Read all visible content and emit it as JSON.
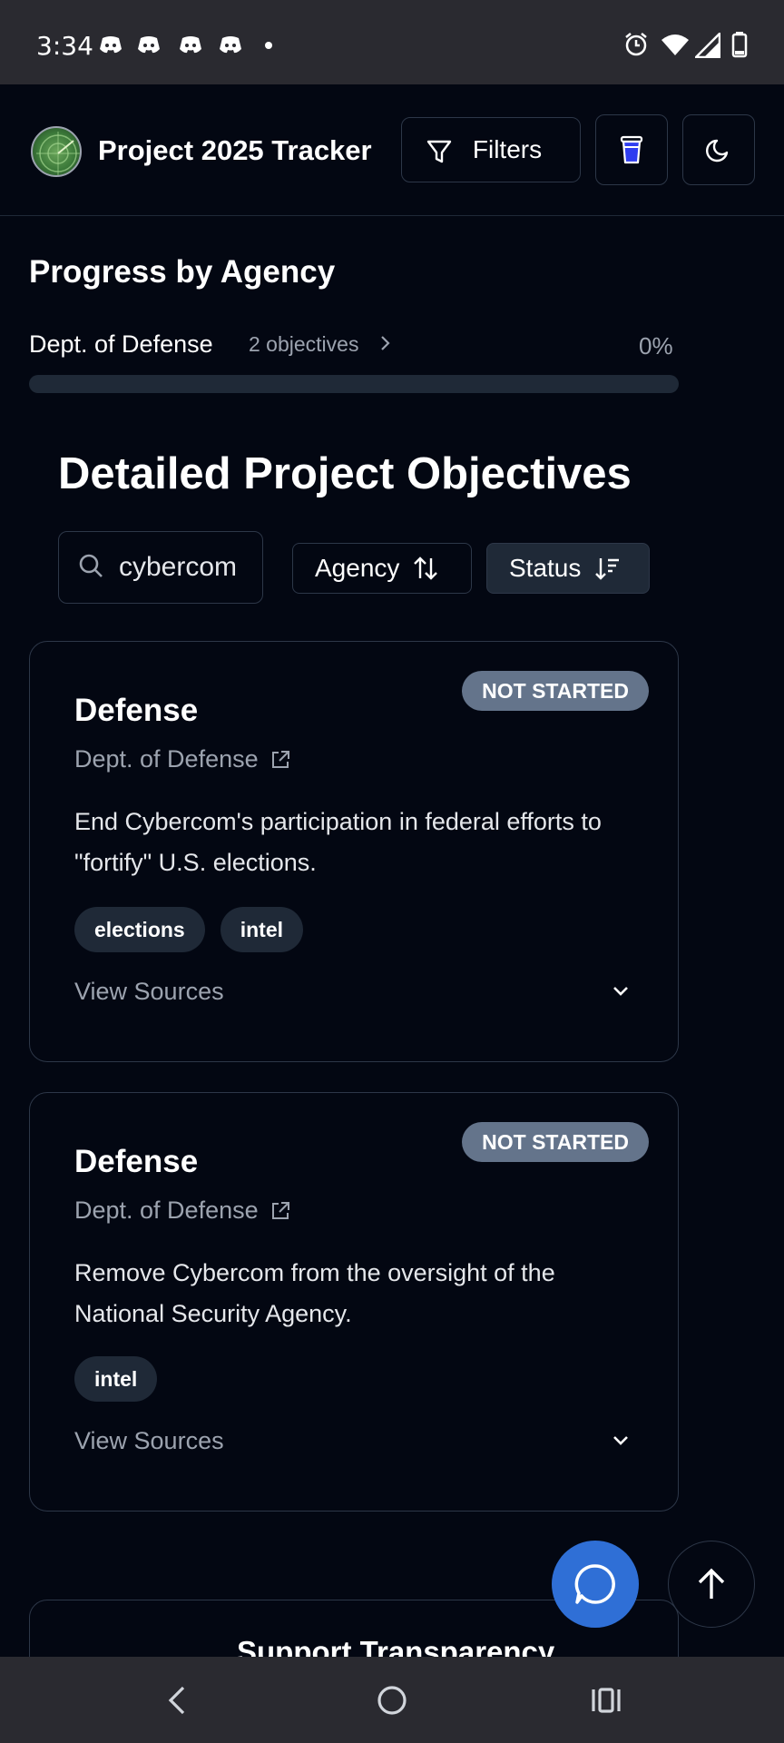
{
  "status_bar": {
    "time": "3:34",
    "notification_icons": [
      "discord-icon",
      "discord-icon",
      "discord-icon",
      "discord-icon"
    ],
    "right_icons": [
      "alarm-icon",
      "wifi-icon",
      "signal-icon",
      "battery-icon"
    ]
  },
  "header": {
    "app_title": "Project 2025 Tracker",
    "filters_label": "Filters",
    "icons": {
      "filter": "filter-icon",
      "cup": "coffee-cup-icon",
      "theme": "moon-icon"
    }
  },
  "progress": {
    "section_title": "Progress by Agency",
    "agencies": [
      {
        "name": "Dept. of Defense",
        "count": "2 objectives",
        "percent_label": "0%",
        "percent": 0
      }
    ]
  },
  "objectives": {
    "title": "Detailed Project Objectives",
    "search_value": "cybercom",
    "sort_agency_label": "Agency",
    "sort_status_label": "Status",
    "cards": [
      {
        "badge": "NOT STARTED",
        "title": "Defense",
        "agency": "Dept. of Defense",
        "description": "End Cybercom's participation in federal efforts to \"fortify\" U.S. elections.",
        "tags": [
          "elections",
          "intel"
        ],
        "view_sources": "View Sources"
      },
      {
        "badge": "NOT STARTED",
        "title": "Defense",
        "agency": "Dept. of Defense",
        "description": "Remove Cybercom from the oversight of the National Security Agency.",
        "tags": [
          "intel"
        ],
        "view_sources": "View Sources"
      }
    ],
    "support_title": "Support Transparency"
  },
  "colors": {
    "background": "#030712",
    "badge_gray": "#64748b",
    "chat_fab": "#2f6fd6",
    "border": "#2d3748"
  }
}
